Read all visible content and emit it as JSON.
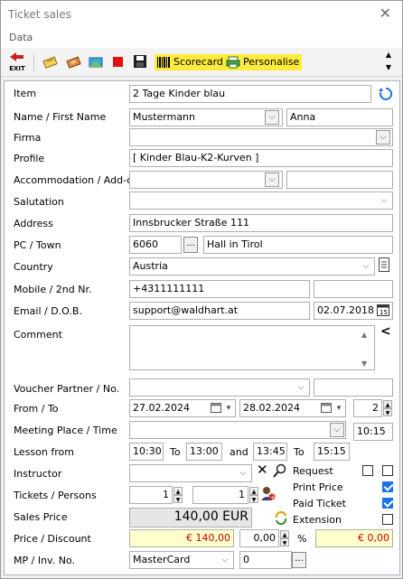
{
  "window": {
    "title": "Ticket sales",
    "menu_data": "Data"
  },
  "toolbar": {
    "exit_label": "EXIT",
    "scorecard_label": "Scorecard",
    "personalise_label": "Personalise"
  },
  "form": {
    "item": {
      "label": "Item",
      "value": "2 Tage Kinder blau"
    },
    "name": {
      "label": "Name / First Name",
      "last": "Mustermann",
      "first": "Anna"
    },
    "firma": {
      "label": "Firma",
      "value": ""
    },
    "profile": {
      "label": "Profile",
      "value": "[ Kinder Blau-K2-Kurven ]"
    },
    "accommodation": {
      "label": "Accommodation / Add-on",
      "value": "",
      "addon": ""
    },
    "salutation": {
      "label": "Salutation",
      "value": ""
    },
    "address": {
      "label": "Address",
      "value": "Innsbrucker Straße 111"
    },
    "pc_town": {
      "label": "PC / Town",
      "pc": "6060",
      "ellipsis": "...",
      "town": "Hall in Tirol"
    },
    "country": {
      "label": "Country",
      "value": "Austria"
    },
    "mobile": {
      "label": "Mobile / 2nd Nr.",
      "value": "+4311111111",
      "second": ""
    },
    "email": {
      "label": "Email / D.O.B.",
      "value": "support@waldhart.at",
      "dob": "02.07.2018"
    },
    "comment": {
      "label": "Comment",
      "value": "",
      "marker": "<"
    },
    "voucher": {
      "label": "Voucher Partner / No.",
      "value": "",
      "no": ""
    },
    "from_to": {
      "label": "From / To",
      "from": "27.02.2024",
      "to": "28.02.2024",
      "days": "2"
    },
    "meeting": {
      "label": "Meeting Place / Time",
      "place": "",
      "time": "10:15"
    },
    "lesson": {
      "label": "Lesson from",
      "from1": "10:30",
      "to_word": "To",
      "to1": "13:00",
      "and_word": "and",
      "from2": "13:45",
      "to_word2": "To",
      "to2": "15:15"
    },
    "instructor": {
      "label": "Instructor",
      "value": ""
    },
    "tickets": {
      "label": "Tickets / Persons",
      "tickets": "1",
      "persons": "1"
    },
    "sales_price": {
      "label": "Sales Price",
      "value": "140,00 EUR"
    },
    "price_discount": {
      "label": "Price / Discount",
      "price": "€ 140,00",
      "discount": "0,00",
      "percent": "%",
      "discount_amount": "€ 0,00"
    },
    "mp_inv": {
      "label": "MP / Inv. No.",
      "mp": "MasterCard",
      "inv": "0",
      "ellipsis": "..."
    }
  },
  "options": {
    "request": {
      "label": "Request",
      "checked": false,
      "checked2": false
    },
    "print_price": {
      "label": "Print Price",
      "checked": true
    },
    "paid_ticket": {
      "label": "Paid Ticket",
      "checked": true
    },
    "extension": {
      "label": "Extension",
      "checked": false
    }
  }
}
